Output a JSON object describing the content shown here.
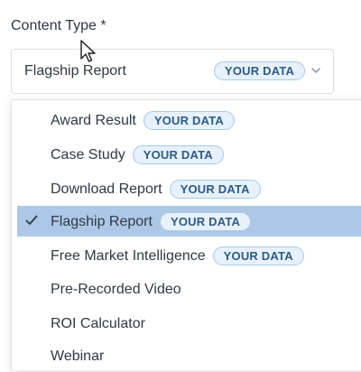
{
  "field": {
    "label": "Content Type *",
    "selected_value": "Flagship Report",
    "selected_badge": "YOUR DATA"
  },
  "menu": {
    "items": [
      {
        "label": "Award Result",
        "badge": "YOUR DATA",
        "selected": false
      },
      {
        "label": "Case Study",
        "badge": "YOUR DATA",
        "selected": false
      },
      {
        "label": "Download Report",
        "badge": "YOUR DATA",
        "selected": false
      },
      {
        "label": "Flagship Report",
        "badge": "YOUR DATA",
        "selected": true
      },
      {
        "label": "Free Market Intelligence",
        "badge": "YOUR DATA",
        "selected": false
      },
      {
        "label": "Pre-Recorded Video",
        "badge": "",
        "selected": false
      },
      {
        "label": "ROI Calculator",
        "badge": "",
        "selected": false
      },
      {
        "label": "Webinar",
        "badge": "",
        "selected": false
      }
    ]
  },
  "icons": {
    "cursor": "mouse-pointer-icon",
    "chevron": "chevron-down-icon",
    "check": "check-icon"
  },
  "colors": {
    "badge_background": "#e7f1fb",
    "badge_border": "#a9c9e6",
    "badge_text": "#2c5b86",
    "selected_row": "#adc8e6",
    "text": "#2f3846"
  }
}
